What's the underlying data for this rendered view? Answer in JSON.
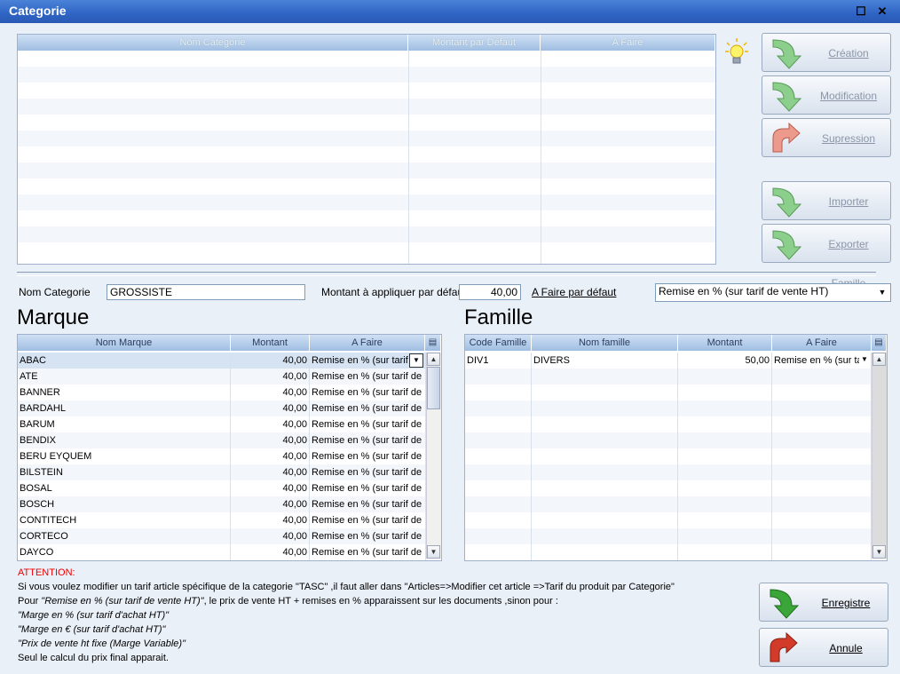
{
  "window": {
    "title": "Categorie"
  },
  "category_grid": {
    "headers": [
      "Nom Categorie",
      "Montant par Défaut",
      "A Faire"
    ]
  },
  "buttons": {
    "creation": "Création",
    "modification": "Modification",
    "suppression": "Supression",
    "importer": "Importer Famille",
    "exporter": "Exporter Famille",
    "enregistre": "Enregistre",
    "annule": "Annule"
  },
  "form": {
    "nom_label": "Nom Categorie",
    "nom_value": "GROSSISTE",
    "montant_label": "Montant à appliquer par défaut",
    "montant_value": "40,00",
    "afaire_label": "A Faire par défaut",
    "afaire_value": "Remise en % (sur tarif de vente HT)"
  },
  "marque": {
    "title": "Marque",
    "headers": [
      "Nom Marque",
      "Montant",
      "A Faire"
    ],
    "rows": [
      [
        "ABAC",
        "40,00",
        "Remise en % (sur tarif de"
      ],
      [
        "ATE",
        "40,00",
        "Remise en % (sur tarif de"
      ],
      [
        "BANNER",
        "40,00",
        "Remise en % (sur tarif de"
      ],
      [
        "BARDAHL",
        "40,00",
        "Remise en % (sur tarif de"
      ],
      [
        "BARUM",
        "40,00",
        "Remise en % (sur tarif de"
      ],
      [
        "BENDIX",
        "40,00",
        "Remise en % (sur tarif de"
      ],
      [
        "BERU EYQUEM",
        "40,00",
        "Remise en % (sur tarif de"
      ],
      [
        "BILSTEIN",
        "40,00",
        "Remise en % (sur tarif de"
      ],
      [
        "BOSAL",
        "40,00",
        "Remise en % (sur tarif de"
      ],
      [
        "BOSCH",
        "40,00",
        "Remise en % (sur tarif de"
      ],
      [
        "CONTITECH",
        "40,00",
        "Remise en % (sur tarif de"
      ],
      [
        "CORTECO",
        "40,00",
        "Remise en % (sur tarif de"
      ],
      [
        "DAYCO",
        "40,00",
        "Remise en % (sur tarif de"
      ]
    ]
  },
  "famille": {
    "title": "Famille",
    "headers": [
      "Code Famille",
      "Nom famille",
      "Montant",
      "A Faire"
    ],
    "rows": [
      [
        "DIV1",
        "DIVERS",
        "50,00",
        "Remise en % (sur tar"
      ]
    ]
  },
  "info": {
    "attention": "ATTENTION:",
    "line1": "Si vous voulez modifier un tarif article spécifique de la categorie \"TASC\" ,il faut aller dans \"Articles=>Modifier cet article =>Tarif du produit par Categorie\"",
    "line2a": "Pour ",
    "line2b": "\"Remise en % (sur tarif de vente HT)\"",
    "line2c": ", le prix de vente HT + remises en % apparaissent sur les documents ,sinon pour :",
    "line3": "\"Marge en % (sur tarif d'achat HT)\"",
    "line4": "\"Marge en € (sur tarif d'achat HT)\"",
    "line5": "\"Prix de vente ht fixe (Marge Variable)\"",
    "line6": "Seul le calcul du prix final apparait."
  },
  "colors": {
    "title_bar": "#2f64c4",
    "header": "#9fbde2",
    "green_arrow": "#3aa63a",
    "red_arrow": "#d23a2a"
  },
  "icons": {
    "tip": "lightbulb-icon",
    "column_chooser": "column-chooser-icon"
  }
}
